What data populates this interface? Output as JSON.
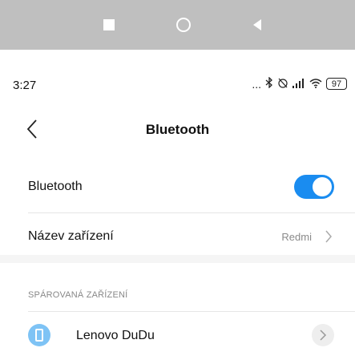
{
  "status": {
    "time": "3:27",
    "dots": "...",
    "battery": "97",
    "icons": [
      "bluetooth-icon",
      "alarm-off-icon",
      "signal-icon",
      "wifi-icon",
      "battery-icon"
    ]
  },
  "header": {
    "title": "Bluetooth"
  },
  "rows": {
    "bluetooth_label": "Bluetooth",
    "bluetooth_enabled": true,
    "device_name_label": "Název zařízení",
    "device_name_value": "Redmi"
  },
  "paired": {
    "section_title": "SPÁROVANÁ ZAŘÍZENÍ",
    "devices": [
      {
        "name": "Lenovo DuDu"
      }
    ]
  },
  "colors": {
    "accent": "#1a8cf0",
    "device_icon": "#7ec3f5"
  }
}
